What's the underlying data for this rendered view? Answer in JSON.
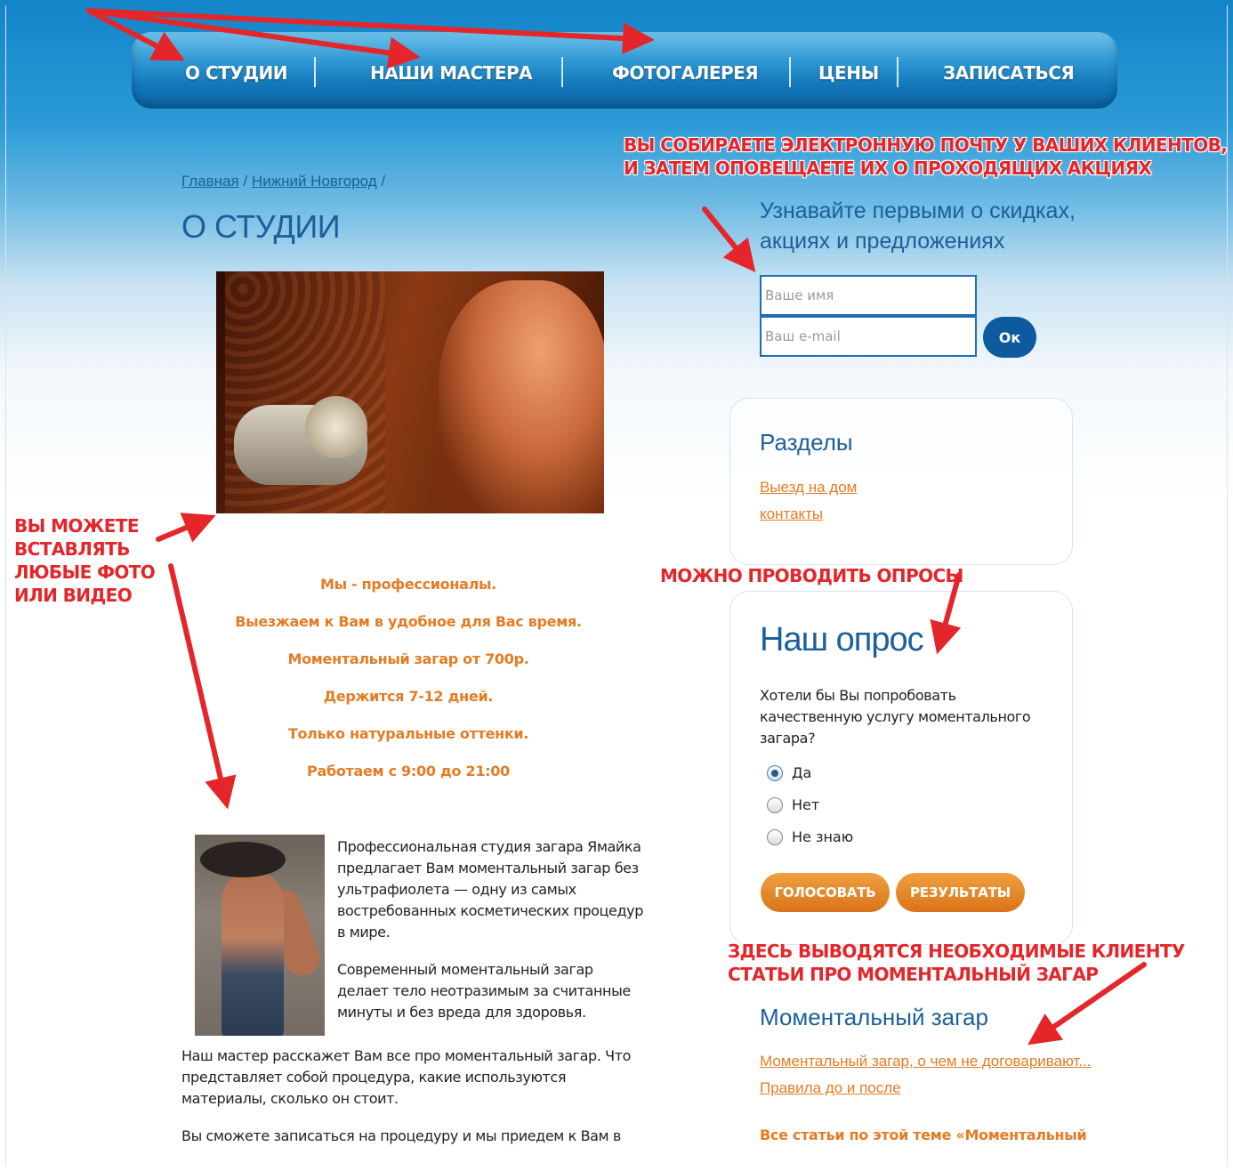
{
  "nav": {
    "items": [
      "О СТУДИИ",
      "НАШИ МАСТЕРА",
      "ФОТОГАЛЕРЕЯ",
      "ЦЕНЫ",
      "ЗАПИСАТЬСЯ"
    ]
  },
  "annotations": {
    "email_line1": "ВЫ СОБИРАЕТЕ ЭЛЕКТРОННУЮ ПОЧТУ У ВАШИХ КЛИЕНТОВ,",
    "email_line2": "И ЗАТЕМ ОПОВЕЩАЕТЕ ИХ О ПРОХОДЯЩИХ АКЦИЯХ",
    "photo_line1": "ВЫ МОЖЕТЕ",
    "photo_line2": "ВСТАВЛЯТЬ",
    "photo_line3": "ЛЮБЫЕ ФОТО",
    "photo_line4": "ИЛИ ВИДЕО",
    "polls": "МОЖНО ПРОВОДИТЬ ОПРОСЫ",
    "articles_line1": "ЗДЕСЬ ВЫВОДЯТСЯ НЕОБХОДИМЫЕ КЛИЕНТУ",
    "articles_line2": "СТАТЬИ ПРО МОМЕНТАЛЬНЫЙ ЗАГАР"
  },
  "breadcrumb": {
    "home": "Главная",
    "city": "Нижний Новгород",
    "sep": "/"
  },
  "page_title": "О СТУДИИ",
  "promo": [
    "Мы - профессионалы.",
    "Выезжаем к Вам в удобное для Вас время.",
    "Моментальный загар от 700р.",
    "Держится 7-12 дней.",
    "Только натуральные оттенки.",
    "Работаем с 9:00 до 21:00"
  ],
  "about": {
    "p1": "Профессиональная студия загара Ямайка предлагает Вам моментальный загар без ультрафиолета — одну из самых востребованных косметических процедур в мире.",
    "p2": "Современный моментальный загар делает тело неотразимым за считанные минуты и без вреда для здоровья.",
    "p3": "Наш мастер расскажет Вам все про моментальный загар. Что представляет собой процедура, какие используются материалы, сколько  он стоит.",
    "p4": "Вы сможете записаться на процедуру и мы приедем к Вам в"
  },
  "subscribe": {
    "title": "Узнавайте первыми о скидках, акциях и предложениях",
    "name_placeholder": "Ваше имя",
    "email_placeholder": "Ваш e-mail",
    "ok_label": "Ок"
  },
  "sections": {
    "title": "Разделы",
    "links": [
      "Выезд на дом",
      "контакты"
    ]
  },
  "poll": {
    "title": "Наш опрос",
    "question": "Хотели бы Вы попробовать качественную услугу моментального загара?",
    "options": [
      "Да",
      "Нет",
      "Не знаю"
    ],
    "selected": "Да",
    "vote_label": "ГОЛОСОВАТЬ",
    "results_label": "РЕЗУЛЬТАТЫ"
  },
  "articles": {
    "title": "Моментальный загар",
    "links": [
      "Моментальный загар, о чем не договаривают...",
      "Правила до и после"
    ],
    "all_label": "Все статьи по этой теме «Моментальный"
  },
  "colors": {
    "brand_blue": "#1b5f9c",
    "accent_orange": "#e47c26",
    "annotation_red": "#e4262a"
  }
}
